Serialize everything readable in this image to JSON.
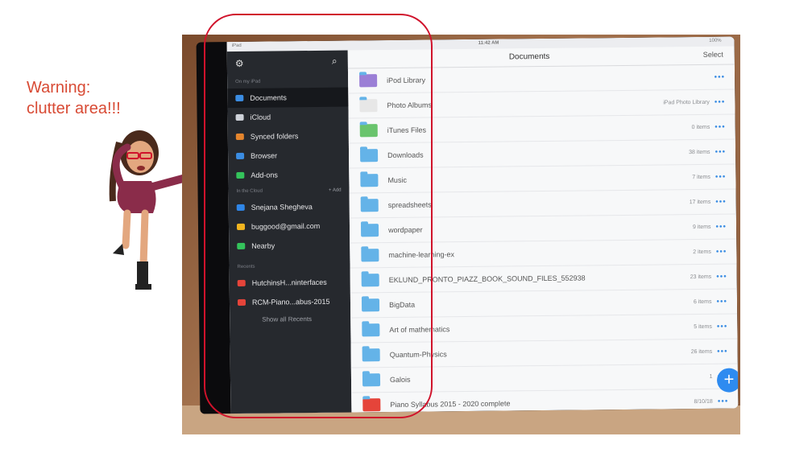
{
  "annotation": {
    "warning_line1": "Warning:",
    "warning_line2": "clutter area!!!",
    "warning_color": "#d84a34",
    "box_color": "#d0122b"
  },
  "status_bar": {
    "carrier": "iPad",
    "time": "11:42 AM",
    "battery": "100%"
  },
  "sidebar": {
    "section_device": "On my iPad",
    "device_items": [
      {
        "label": "Documents",
        "icon": "folder-icon",
        "color": "#3b8de3"
      },
      {
        "label": "iCloud",
        "icon": "cloud-icon",
        "color": "#cfd3da"
      },
      {
        "label": "Synced folders",
        "icon": "synced-folder-icon",
        "color": "#e5852d"
      },
      {
        "label": "Browser",
        "icon": "compass-icon",
        "color": "#3b8de3"
      },
      {
        "label": "Add-ons",
        "icon": "cart-icon",
        "color": "#34c35b"
      }
    ],
    "section_cloud": "In the Cloud",
    "add_label": "+ Add",
    "cloud_items": [
      {
        "label": "Snejana Shegheva",
        "icon": "dropbox-icon",
        "color": "#2f86e8"
      },
      {
        "label": "buggood@gmail.com",
        "icon": "google-drive-icon",
        "color": "#f2b51f"
      },
      {
        "label": "Nearby",
        "icon": "nearby-icon",
        "color": "#34c35b"
      }
    ],
    "section_recents": "Recents",
    "recent_items": [
      {
        "label": "HutchinsH...ninterfaces",
        "icon": "pdf-icon",
        "color": "#e5443a"
      },
      {
        "label": "RCM-Piano...abus-2015",
        "icon": "pdf-icon",
        "color": "#e5443a"
      }
    ],
    "show_all_recents": "Show all Recents"
  },
  "main": {
    "title": "Documents",
    "select": "Select",
    "more": "•••",
    "rows": [
      {
        "name": "iPod Library",
        "count": "",
        "color": "#9b7fd6"
      },
      {
        "name": "Photo Albums",
        "count": "iPad Photo Library",
        "color": "#e7e7e7"
      },
      {
        "name": "iTunes Files",
        "count": "0 items",
        "color": "#6ac46d"
      },
      {
        "name": "Downloads",
        "count": "38 items",
        "color": "#64b3e8"
      },
      {
        "name": "Music",
        "count": "7 items",
        "color": "#64b3e8"
      },
      {
        "name": "spreadsheets",
        "count": "17 items",
        "color": "#64b3e8"
      },
      {
        "name": "wordpaper",
        "count": "9 items",
        "color": "#64b3e8"
      },
      {
        "name": "machine-learning-ex",
        "count": "2 items",
        "color": "#64b3e8"
      },
      {
        "name": "EKLUND_PRONTO_PIAZZ_BOOK_SOUND_FILES_552938",
        "count": "23 items",
        "color": "#64b3e8"
      },
      {
        "name": "BigData",
        "count": "6 items",
        "color": "#64b3e8"
      },
      {
        "name": "Art of mathematics",
        "count": "5 items",
        "color": "#64b3e8"
      },
      {
        "name": "Quantum-Physics",
        "count": "26 items",
        "color": "#64b3e8"
      },
      {
        "name": "Galois",
        "count": "1",
        "color": "#64b3e8"
      },
      {
        "name": "Piano Syllabus 2015 - 2020 complete",
        "count": "8/10/18",
        "color": "#e5443a"
      }
    ],
    "fab_label": "+"
  }
}
